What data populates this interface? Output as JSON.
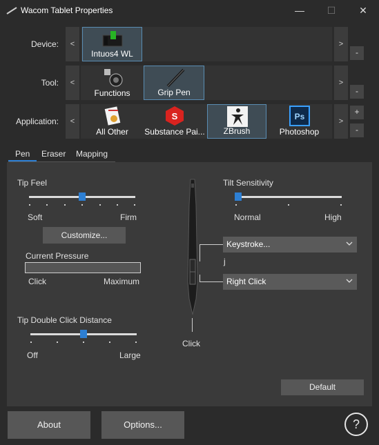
{
  "window": {
    "title": "Wacom Tablet Properties",
    "minimize": "—",
    "maximize": "☐",
    "close": "✕"
  },
  "rows": {
    "device": {
      "label": "Device:",
      "items": [
        {
          "label": "Intuos4 WL",
          "icon": "tablet-icon"
        }
      ]
    },
    "tool": {
      "label": "Tool:",
      "items": [
        {
          "label": "Functions",
          "icon": "functions-icon"
        },
        {
          "label": "Grip Pen",
          "icon": "pen-icon"
        }
      ]
    },
    "application": {
      "label": "Application:",
      "items": [
        {
          "label": "All Other",
          "icon": "all-other-icon"
        },
        {
          "label": "Substance Pai...",
          "icon": "substance-painter-icon"
        },
        {
          "label": "ZBrush",
          "icon": "zbrush-icon"
        },
        {
          "label": "Photoshop",
          "icon": "photoshop-icon"
        }
      ]
    }
  },
  "arrows": {
    "left": "<",
    "right": ">",
    "plus": "+",
    "minus": "-"
  },
  "tabs": [
    "Pen",
    "Eraser",
    "Mapping"
  ],
  "tip_feel": {
    "label": "Tip Feel",
    "min": "Soft",
    "max": "Firm",
    "level": 0.5
  },
  "customize_button": "Customize...",
  "current_pressure": {
    "label": "Current Pressure",
    "min": "Click",
    "max": "Maximum",
    "value": 0
  },
  "tip_double_click": {
    "label": "Tip Double Click Distance",
    "min": "Off",
    "max": "Large",
    "level": 0.5
  },
  "tilt": {
    "label": "Tilt Sensitivity",
    "min": "Normal",
    "max": "High",
    "level": 0
  },
  "pen_buttons": {
    "upper": "Keystroke...",
    "upper_note": "j",
    "lower": "Right Click",
    "tip": "Click"
  },
  "default_button": "Default",
  "about_button": "About",
  "options_button": "Options...",
  "help_icon": "?",
  "colors": {
    "accent": "#2d7fd3",
    "selection_border": "#5a8db3"
  }
}
